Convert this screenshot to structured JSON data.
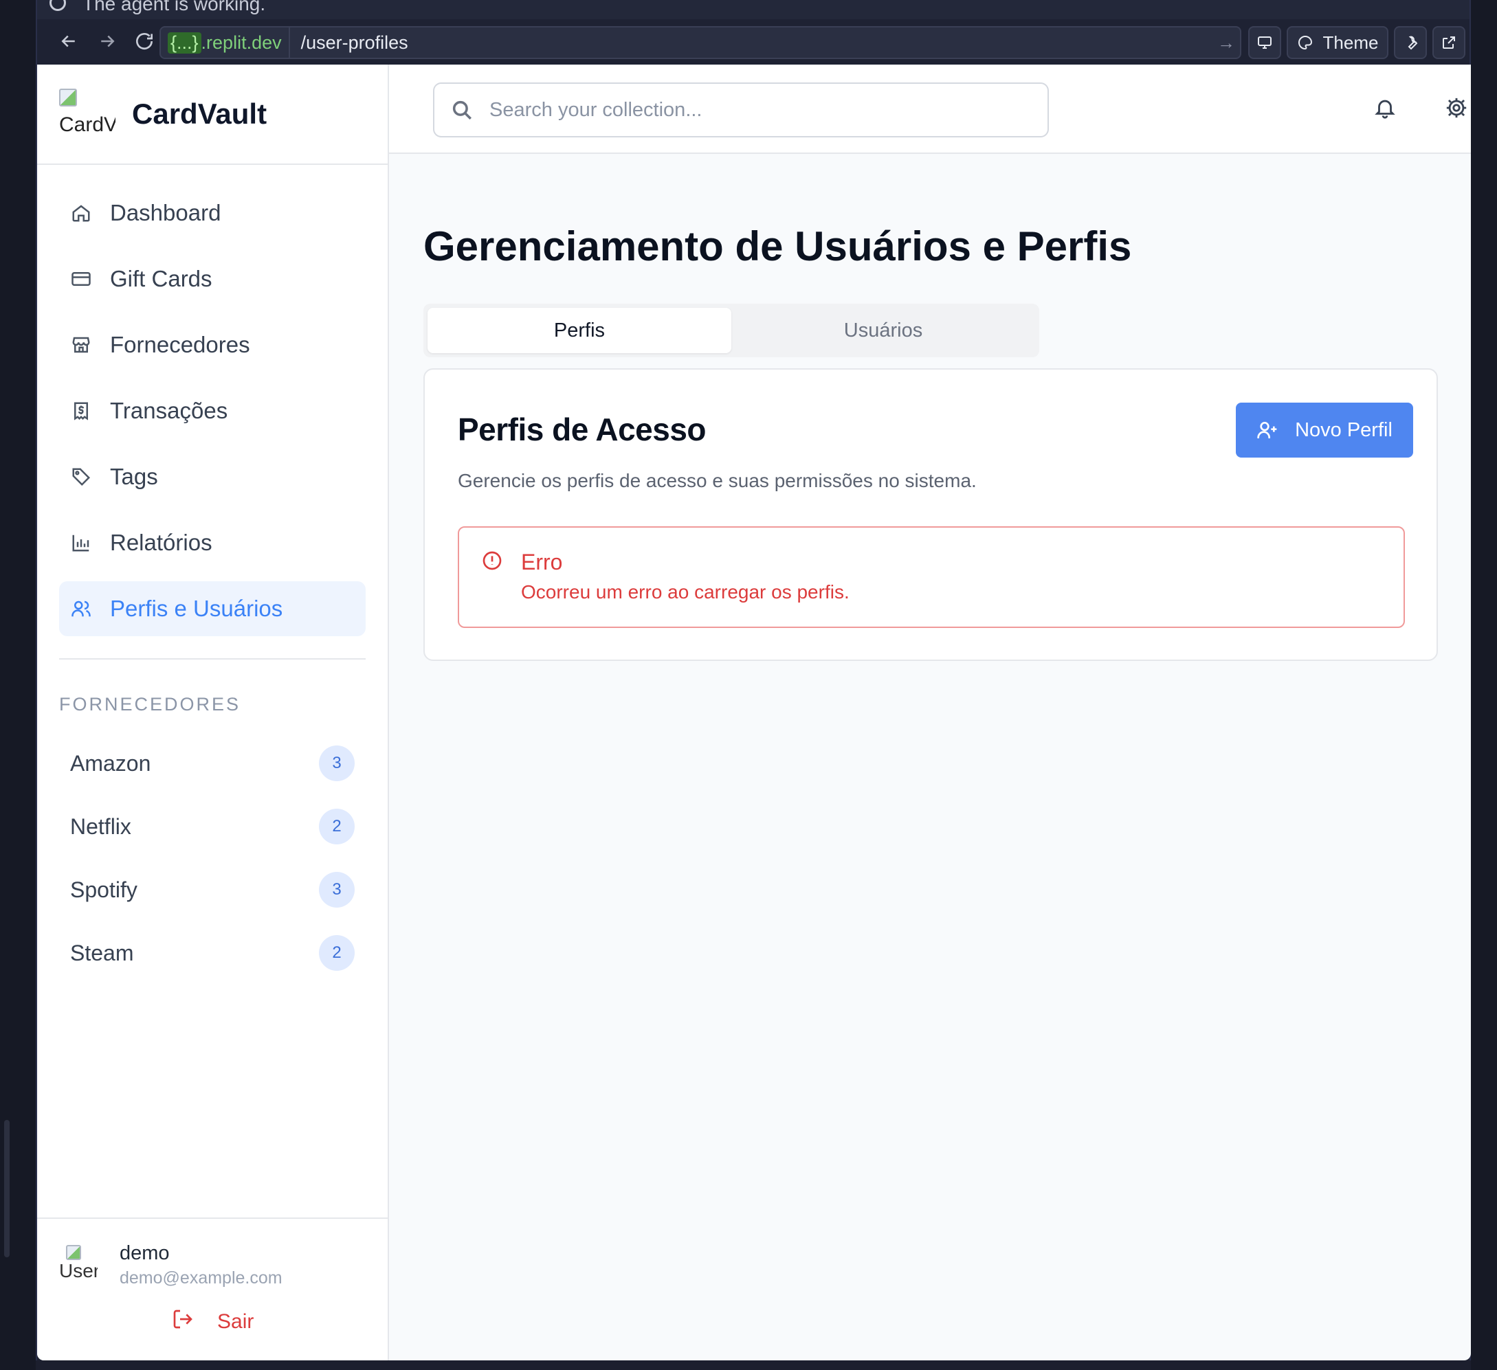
{
  "agent_bar": {
    "status": "The agent is working."
  },
  "browser": {
    "host_curly": "{...}",
    "host_domain": ".replit.dev",
    "path": "/user-profiles",
    "theme_label": "Theme"
  },
  "brand": {
    "logo_alt": "CardVault",
    "name": "CardVault"
  },
  "nav": {
    "items": [
      {
        "label": "Dashboard",
        "icon": "home-icon"
      },
      {
        "label": "Gift Cards",
        "icon": "credit-card-icon"
      },
      {
        "label": "Fornecedores",
        "icon": "store-icon"
      },
      {
        "label": "Transações",
        "icon": "receipt-icon"
      },
      {
        "label": "Tags",
        "icon": "tag-icon"
      },
      {
        "label": "Relatórios",
        "icon": "bar-chart-icon"
      },
      {
        "label": "Perfis e Usuários",
        "icon": "users-icon",
        "active": true
      }
    ]
  },
  "vendors": {
    "title": "FORNECEDORES",
    "items": [
      {
        "name": "Amazon",
        "count": "3"
      },
      {
        "name": "Netflix",
        "count": "2"
      },
      {
        "name": "Spotify",
        "count": "3"
      },
      {
        "name": "Steam",
        "count": "2"
      }
    ]
  },
  "user": {
    "avatar_alt": "User",
    "name": "demo",
    "email": "demo@example.com",
    "logout_label": "Sair"
  },
  "topbar": {
    "search_placeholder": "Search your collection..."
  },
  "main": {
    "title": "Gerenciamento de Usuários e Perfis",
    "tabs": [
      {
        "label": "Perfis",
        "active": true
      },
      {
        "label": "Usuários"
      }
    ],
    "card": {
      "title": "Perfis de Acesso",
      "description": "Gerencie os perfis de acesso e suas permissões no sistema.",
      "new_button": "Novo Perfil",
      "alert_title": "Erro",
      "alert_message": "Ocorreu um erro ao carregar os perfis."
    }
  },
  "colors": {
    "accent": "#4f86f0",
    "active_nav": "#3b82f6",
    "error": "#dc3c3c"
  }
}
